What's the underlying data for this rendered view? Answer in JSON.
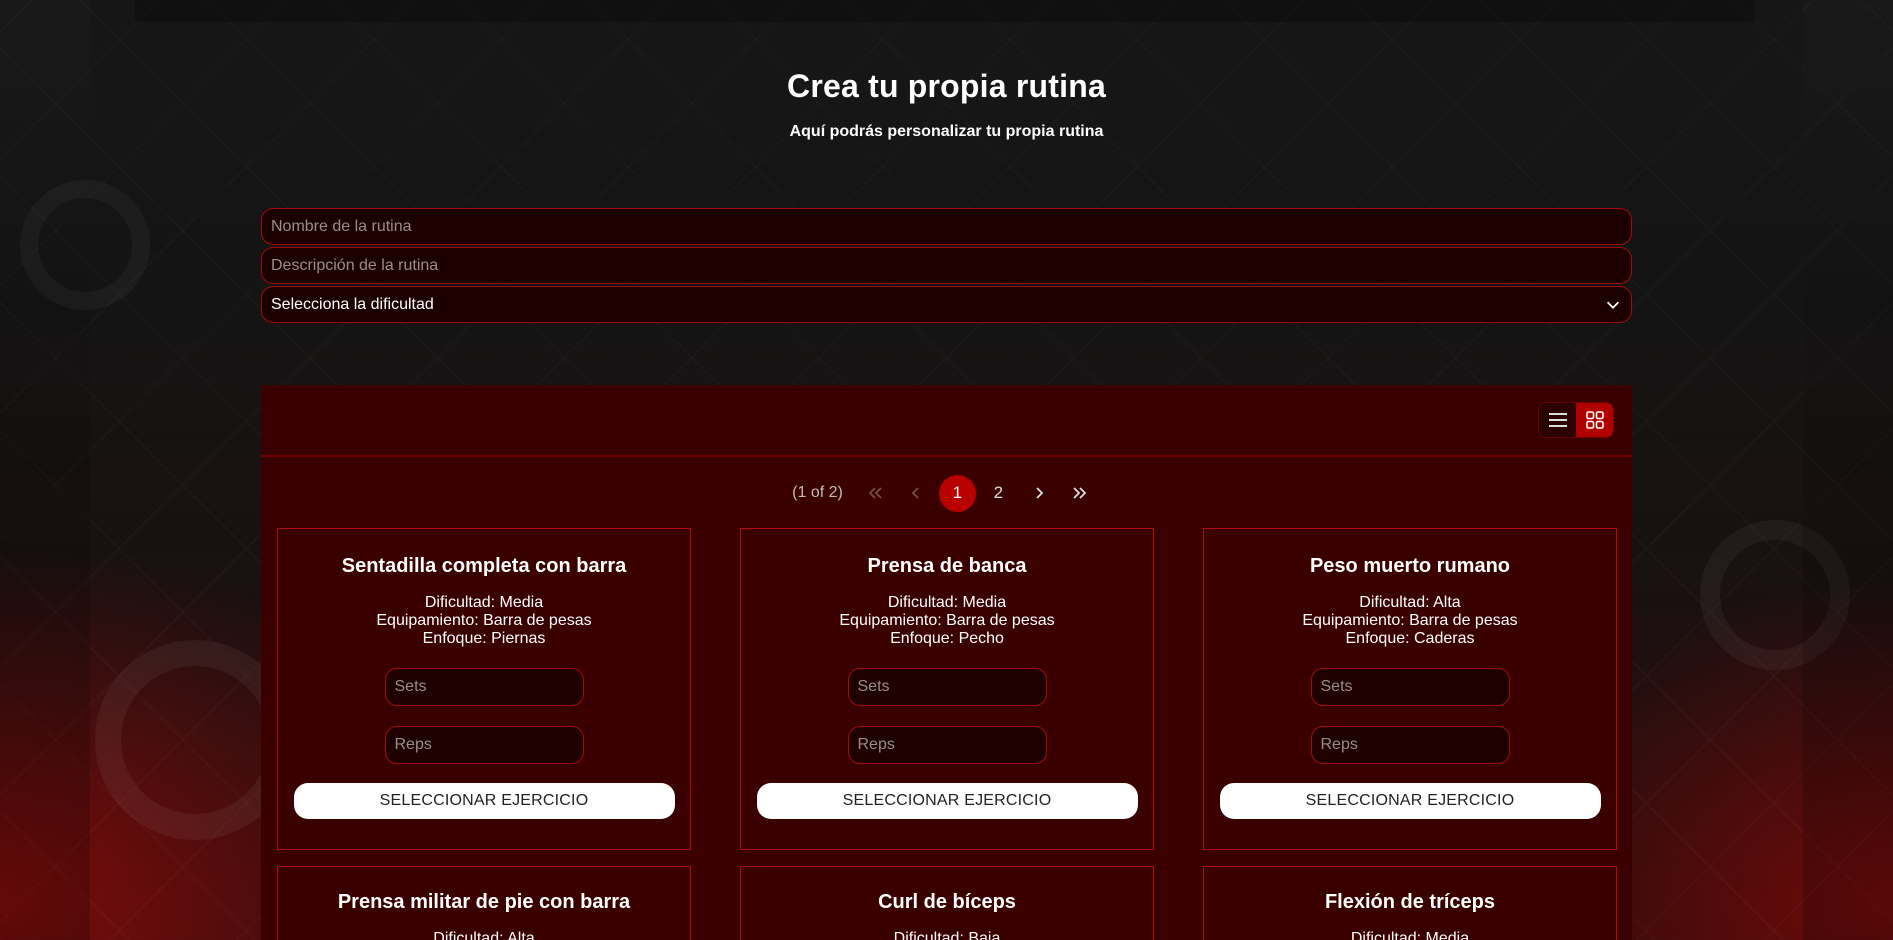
{
  "header": {
    "title": "Crea tu propia rutina",
    "subtitle": "Aquí podrás personalizar tu propia rutina"
  },
  "form": {
    "name_placeholder": "Nombre de la rutina",
    "description_placeholder": "Descripción de la rutina",
    "difficulty_selected": "Selecciona la dificultad"
  },
  "paginator": {
    "report": "(1 of 2)",
    "pages": [
      "1",
      "2"
    ],
    "current_page": "1"
  },
  "cards": [
    {
      "title": "Sentadilla completa con barra",
      "difficulty": "Dificultad: Media",
      "equipment": "Equipamiento: Barra de pesas",
      "focus": "Enfoque: Piernas",
      "sets_placeholder": "Sets",
      "reps_placeholder": "Reps",
      "button": "SELECCIONAR EJERCICIO"
    },
    {
      "title": "Prensa de banca",
      "difficulty": "Dificultad: Media",
      "equipment": "Equipamiento: Barra de pesas",
      "focus": "Enfoque: Pecho",
      "sets_placeholder": "Sets",
      "reps_placeholder": "Reps",
      "button": "SELECCIONAR EJERCICIO"
    },
    {
      "title": "Peso muerto rumano",
      "difficulty": "Dificultad: Alta",
      "equipment": "Equipamiento: Barra de pesas",
      "focus": "Enfoque: Caderas",
      "sets_placeholder": "Sets",
      "reps_placeholder": "Reps",
      "button": "SELECCIONAR EJERCICIO"
    },
    {
      "title": "Prensa militar de pie con barra",
      "difficulty": "Dificultad: Alta"
    },
    {
      "title": "Curl de bíceps",
      "difficulty": "Dificultad: Baja"
    },
    {
      "title": "Flexión de tríceps",
      "difficulty": "Dificultad: Media"
    }
  ],
  "colors": {
    "accent": "#b80000",
    "panel": "#3a0000",
    "border": "#a00c0c",
    "field_bg": "#1c0000"
  },
  "icons": {
    "list_view": "list-view-icon",
    "grid_view": "grid-view-icon",
    "first": "double-chevron-left-icon",
    "prev": "chevron-left-icon",
    "next": "chevron-right-icon",
    "last": "double-chevron-right-icon",
    "dropdown": "chevron-down-icon"
  }
}
